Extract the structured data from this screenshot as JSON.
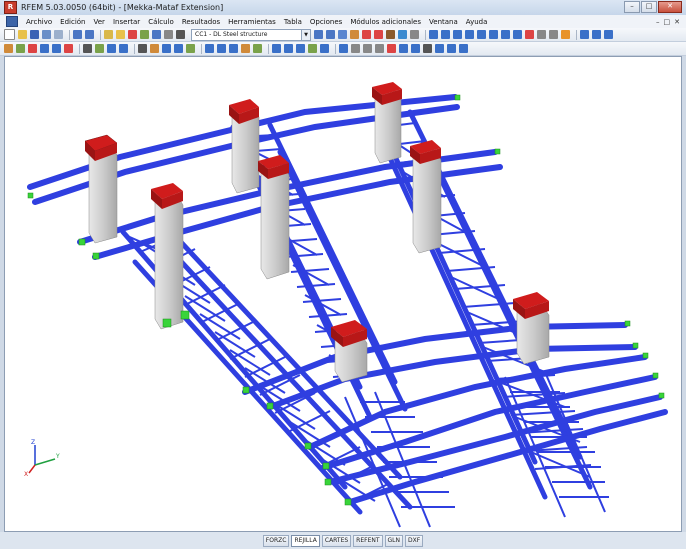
{
  "window": {
    "title": "RFEM 5.03.0050 (64bit) - [Mekka-Mataf Extension]",
    "app_icon": "rfem-logo-icon",
    "controls": [
      "–",
      "□",
      "✕"
    ]
  },
  "menu": {
    "items": [
      "Archivo",
      "Edición",
      "Ver",
      "Insertar",
      "Cálculo",
      "Resultados",
      "Herramientas",
      "Tabla",
      "Opciones",
      "Módulos adicionales",
      "Ventana",
      "Ayuda"
    ],
    "mdi_controls": [
      "–",
      "□",
      "✕"
    ]
  },
  "toolbar": {
    "load_case": "CC1 - DL Steel structure"
  },
  "axes": {
    "x": "X",
    "y": "Y",
    "z": "Z"
  },
  "statusbar": {
    "buttons": [
      "FORZC",
      "REJILLA",
      "CARTES",
      "REFENT",
      "GLN",
      "DXF"
    ],
    "active": "REJILLA"
  },
  "colors": {
    "beam": "#2f3fe0",
    "column": "#c4c4c4",
    "cap": "#b01818",
    "support": "#39d43a"
  }
}
